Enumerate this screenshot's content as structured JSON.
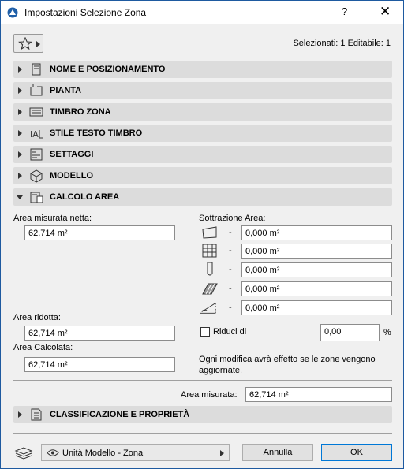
{
  "window": {
    "title": "Impostazioni Selezione Zona",
    "help_label": "?",
    "close_label": "✕"
  },
  "selection_info": "Selezionati: 1 Editabile: 1",
  "sections": {
    "nome": "NOME E POSIZIONAMENTO",
    "pianta": "PIANTA",
    "timbro": "TIMBRO ZONA",
    "stile": "STILE TESTO TIMBRO",
    "settaggi": "SETTAGGI",
    "modello": "MODELLO",
    "calcolo": "CALCOLO AREA",
    "classificazione": "CLASSIFICAZIONE E PROPRIETÀ"
  },
  "calcolo": {
    "area_netta_label": "Area misurata netta:",
    "area_netta_value": "62,714 m²",
    "sottrazione_label": "Sottrazione Area:",
    "sottrazione_values": [
      "0,000 m²",
      "0,000 m²",
      "0,000 m²",
      "0,000 m²",
      "0,000 m²"
    ],
    "dash": "-",
    "area_ridotta_label": "Area ridotta:",
    "area_ridotta_value": "62,714 m²",
    "area_calcolata_label": "Area Calcolata:",
    "area_calcolata_value": "62,714 m²",
    "riduci_label": "Riduci di",
    "riduci_value": "0,00",
    "riduci_unit": "%",
    "note": "Ogni modifica avrà effetto se le zone vengono aggiornate.",
    "area_misurata_label": "Area misurata:",
    "area_misurata_value": "62,714 m²"
  },
  "footer": {
    "view_combo": "Unità Modello - Zona",
    "cancel_label": "Annulla",
    "ok_label": "OK"
  },
  "colors": {
    "accent": "#0078d7",
    "section_bg": "#dcdcdc"
  }
}
